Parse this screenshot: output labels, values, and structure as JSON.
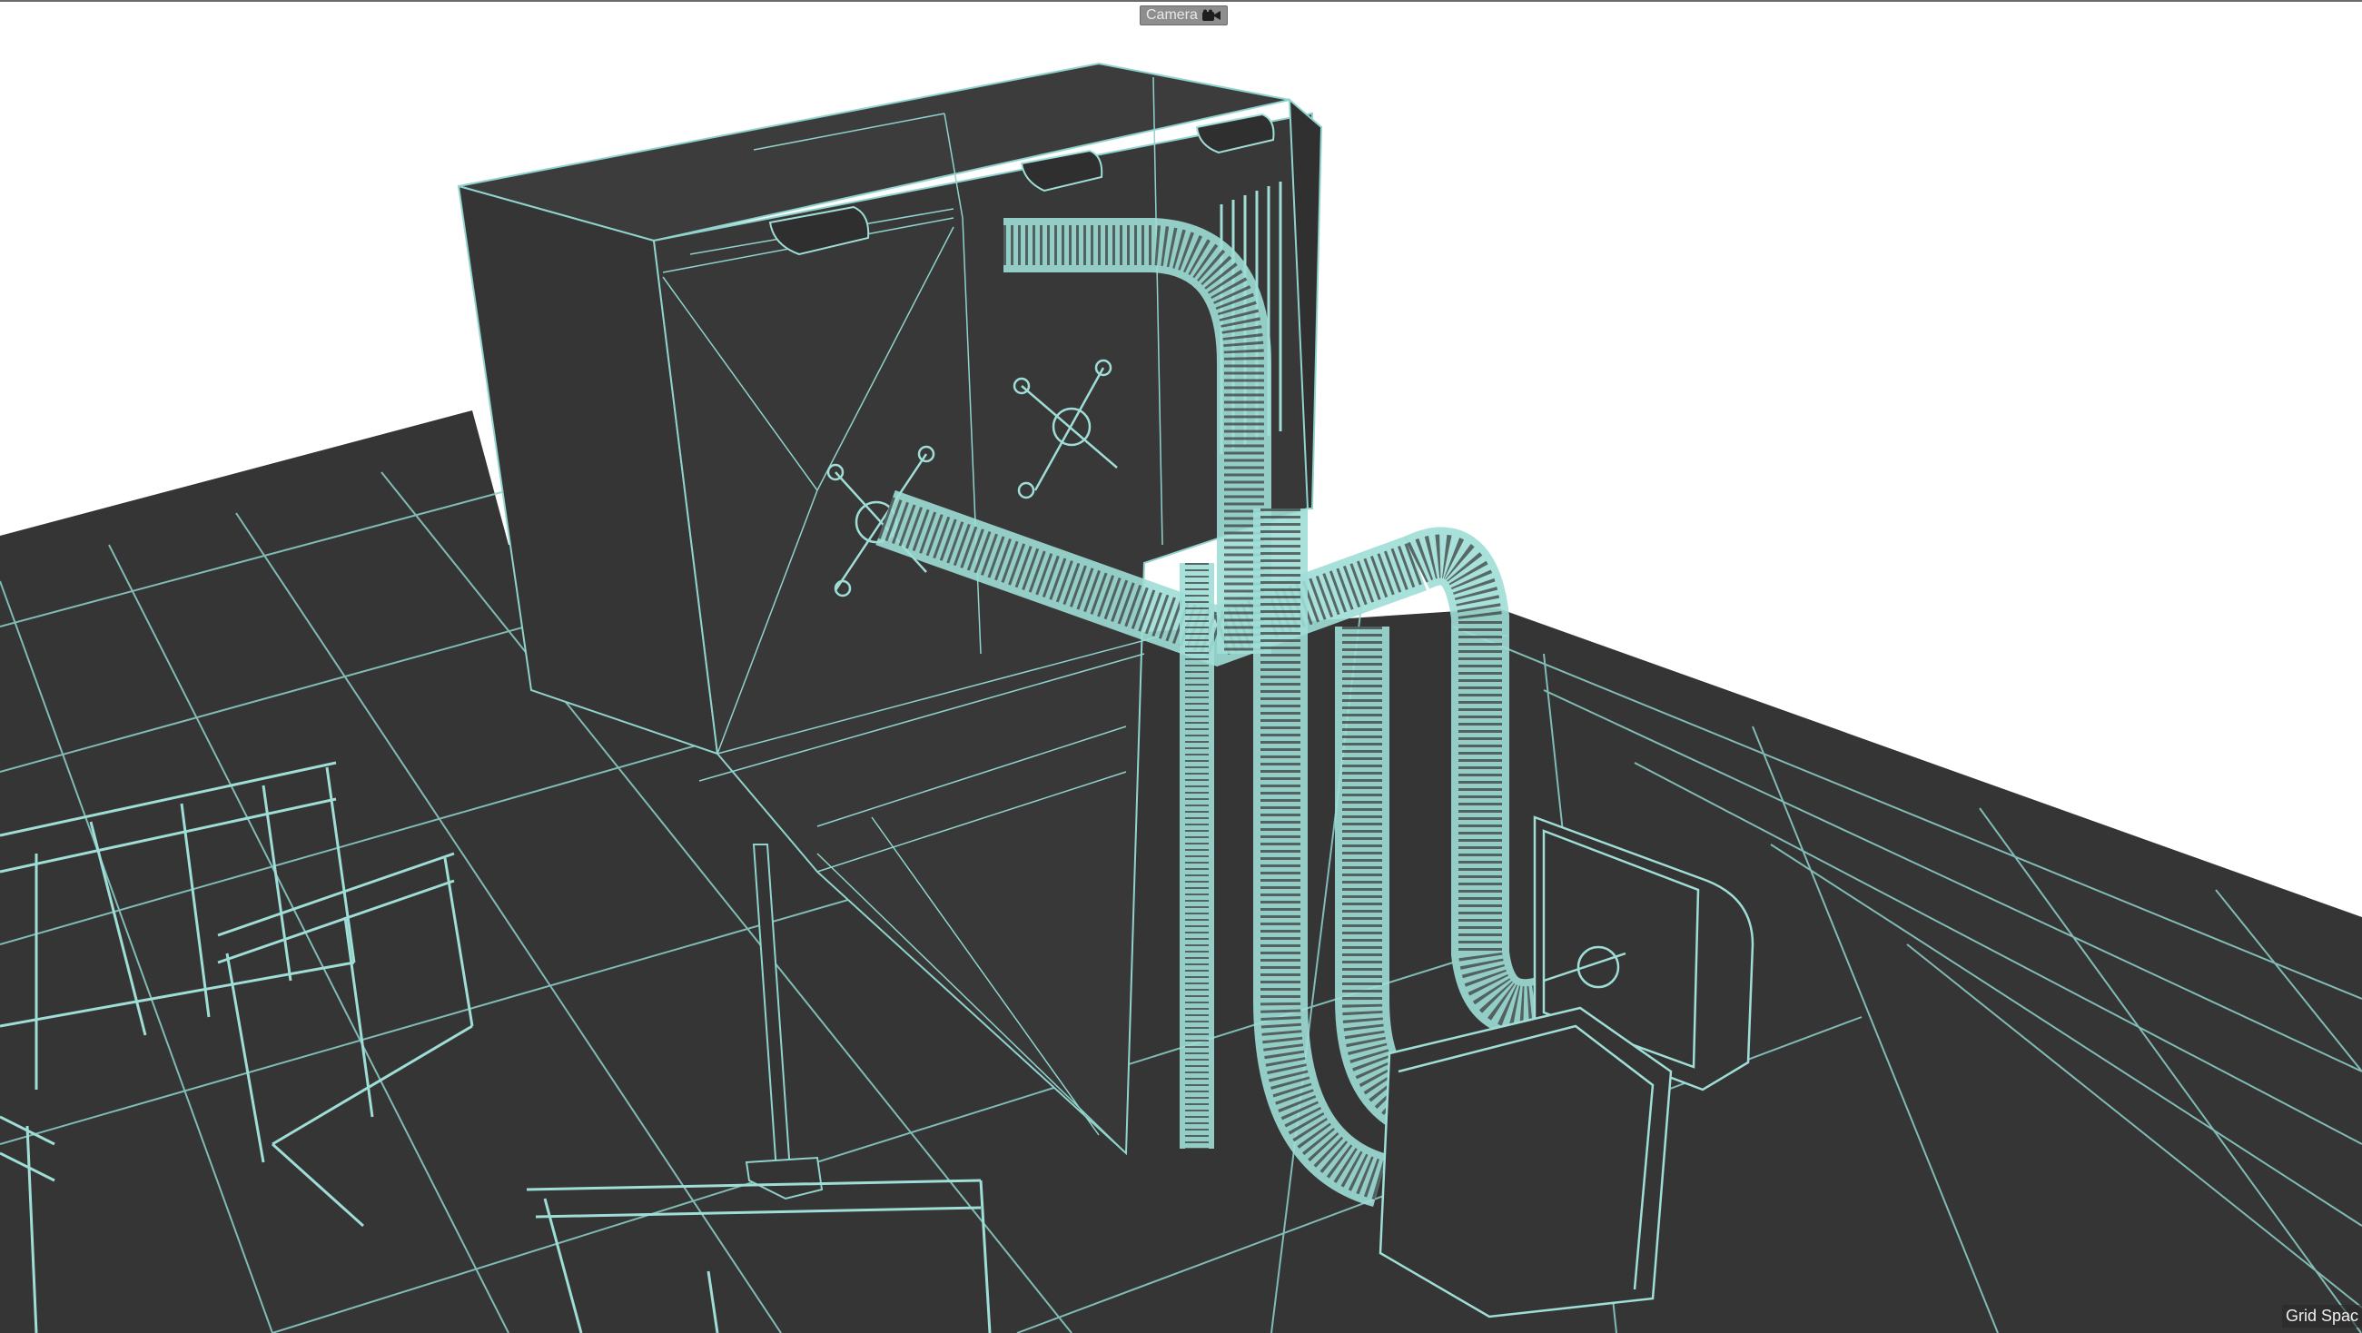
{
  "viewport": {
    "camera_label": "Camera",
    "grid_label": "Grid Spac",
    "colors": {
      "background": "#ffffff",
      "surface": "#353535",
      "wire": "#8fd3cc",
      "wire_dense": "#9fded6"
    },
    "icons": {
      "camera": "camera-icon"
    }
  }
}
